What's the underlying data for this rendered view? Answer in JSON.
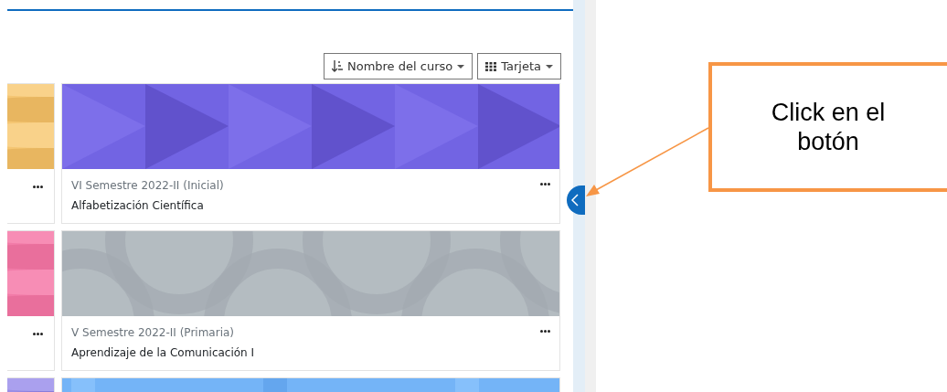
{
  "sort_button": {
    "label": "Nombre del curso"
  },
  "view_button": {
    "label": "Tarjeta"
  },
  "rows": [
    {
      "kind": "course",
      "category": "VI Semestre 2022-II (Inicial)",
      "name": "Alfabetización Científica"
    },
    {
      "kind": "course",
      "category": "V Semestre 2022-II (Primaria)",
      "name": "Aprendizaje de la Comunicación I"
    },
    {
      "kind": "image-only"
    }
  ],
  "annotation": {
    "text": "Click en el botón"
  }
}
